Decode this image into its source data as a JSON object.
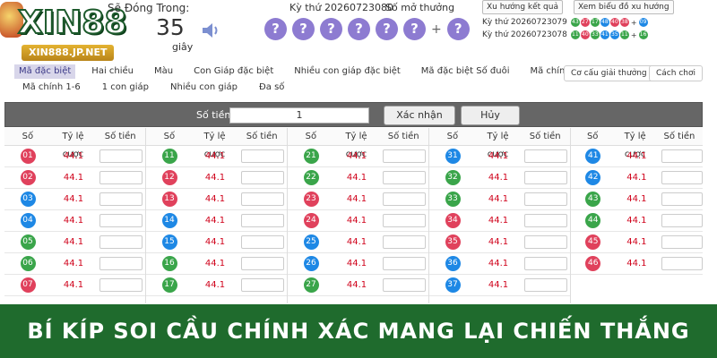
{
  "logo": {
    "brand": "XIN88",
    "website": "XIN888.JP.NET"
  },
  "countdown": {
    "label": "Sẽ Đóng Trong:",
    "value": "35",
    "unit": "giây"
  },
  "draw": {
    "period_label": "Kỳ thứ 20260723080",
    "result_label": "Số mở thưởng",
    "balls": [
      "?",
      "?",
      "?",
      "?",
      "?",
      "?"
    ],
    "plus": "+",
    "special": "?",
    "ball_color": "#8d7bd1"
  },
  "history": {
    "trend_button": "Xu hướng kết quả",
    "chart_button": "Xem biểu đồ xu hướng",
    "rows": [
      {
        "label": "Kỳ thứ 20260723079",
        "numbers": [
          "43",
          "27",
          "17",
          "48",
          "40",
          "38"
        ],
        "colors": [
          "#3aa54a",
          "#e0415c",
          "#3aa54a",
          "#1e88e5",
          "#e0415c",
          "#e0415c"
        ],
        "special": "09",
        "special_color": "#1e88e5"
      },
      {
        "label": "Kỳ thứ 20260723078",
        "numbers": [
          "11",
          "40",
          "33",
          "41",
          "35",
          "11"
        ],
        "colors": [
          "#3aa54a",
          "#e0415c",
          "#3aa54a",
          "#1e88e5",
          "#1e88e5",
          "#3aa54a"
        ],
        "special": "16",
        "special_color": "#3aa54a"
      }
    ]
  },
  "tabs_row1": [
    "Mã đặc biệt",
    "Hai chiều",
    "Màu",
    "Con Giáp đặc biệt",
    "Nhiều con giáp đặc biệt",
    "Mã đặc biệt Số đuôi",
    "Mã chính đặc biệt"
  ],
  "tabs_row2": [
    "Mã chính 1-6",
    "1 con giáp",
    "Nhiều con giáp",
    "Đa số"
  ],
  "right_buttons": {
    "payout": "Cơ cấu giải thưởng",
    "howto": "Cách chơi"
  },
  "bet": {
    "label": "Số tiền",
    "amount": "1",
    "confirm": "Xác nhận cược",
    "cancel": "Hủy"
  },
  "grid": {
    "headers": {
      "number": "Số",
      "odds": "Tỷ lệ cược",
      "amount": "Số tiền"
    },
    "columns": [
      {
        "rows": [
          {
            "n": "01",
            "odds": "44.1",
            "color": "#e0415c"
          },
          {
            "n": "02",
            "odds": "44.1",
            "color": "#e0415c"
          },
          {
            "n": "03",
            "odds": "44.1",
            "color": "#1e88e5"
          },
          {
            "n": "04",
            "odds": "44.1",
            "color": "#1e88e5"
          },
          {
            "n": "05",
            "odds": "44.1",
            "color": "#3aa54a"
          },
          {
            "n": "06",
            "odds": "44.1",
            "color": "#3aa54a"
          },
          {
            "n": "07",
            "odds": "44.1",
            "color": "#e0415c"
          }
        ]
      },
      {
        "rows": [
          {
            "n": "11",
            "odds": "44.1",
            "color": "#3aa54a"
          },
          {
            "n": "12",
            "odds": "44.1",
            "color": "#e0415c"
          },
          {
            "n": "13",
            "odds": "44.1",
            "color": "#e0415c"
          },
          {
            "n": "14",
            "odds": "44.1",
            "color": "#1e88e5"
          },
          {
            "n": "15",
            "odds": "44.1",
            "color": "#1e88e5"
          },
          {
            "n": "16",
            "odds": "44.1",
            "color": "#3aa54a"
          },
          {
            "n": "17",
            "odds": "44.1",
            "color": "#3aa54a"
          }
        ]
      },
      {
        "rows": [
          {
            "n": "21",
            "odds": "44.1",
            "color": "#3aa54a"
          },
          {
            "n": "22",
            "odds": "44.1",
            "color": "#3aa54a"
          },
          {
            "n": "23",
            "odds": "44.1",
            "color": "#e0415c"
          },
          {
            "n": "24",
            "odds": "44.1",
            "color": "#e0415c"
          },
          {
            "n": "25",
            "odds": "44.1",
            "color": "#1e88e5"
          },
          {
            "n": "26",
            "odds": "44.1",
            "color": "#1e88e5"
          },
          {
            "n": "27",
            "odds": "44.1",
            "color": "#3aa54a"
          }
        ]
      },
      {
        "rows": [
          {
            "n": "31",
            "odds": "44.1",
            "color": "#1e88e5"
          },
          {
            "n": "32",
            "odds": "44.1",
            "color": "#3aa54a"
          },
          {
            "n": "33",
            "odds": "44.1",
            "color": "#3aa54a"
          },
          {
            "n": "34",
            "odds": "44.1",
            "color": "#e0415c"
          },
          {
            "n": "35",
            "odds": "44.1",
            "color": "#e0415c"
          },
          {
            "n": "36",
            "odds": "44.1",
            "color": "#1e88e5"
          },
          {
            "n": "37",
            "odds": "44.1",
            "color": "#1e88e5"
          }
        ]
      },
      {
        "rows": [
          {
            "n": "41",
            "odds": "44.1",
            "color": "#1e88e5"
          },
          {
            "n": "42",
            "odds": "44.1",
            "color": "#1e88e5"
          },
          {
            "n": "43",
            "odds": "44.1",
            "color": "#3aa54a"
          },
          {
            "n": "44",
            "odds": "44.1",
            "color": "#3aa54a"
          },
          {
            "n": "45",
            "odds": "44.1",
            "color": "#e0415c"
          },
          {
            "n": "46",
            "odds": "44.1",
            "color": "#e0415c"
          }
        ]
      }
    ]
  },
  "banner": {
    "text": "BÍ KÍP SOI CẦU CHÍNH XÁC MANG LẠI CHIẾN THẮNG"
  }
}
